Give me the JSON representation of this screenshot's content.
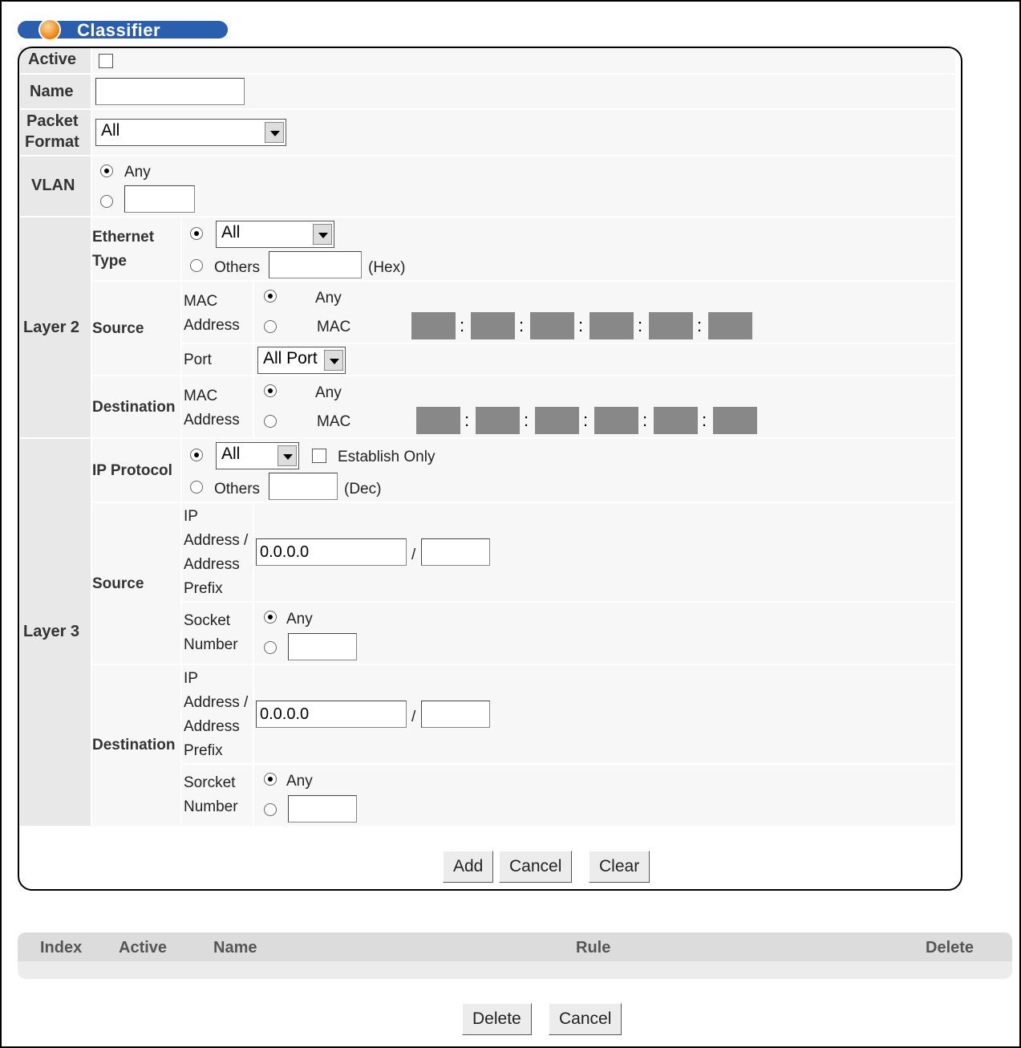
{
  "title": "Classifier",
  "fields": {
    "active_label": "Active",
    "name_label": "Name",
    "name_value": "",
    "packet_label_1": "Packet",
    "packet_label_2": "Format",
    "packet_value": "All",
    "vlan_label": "VLAN",
    "vlan_any": "Any",
    "vlan_value": ""
  },
  "layer2": {
    "label": "Layer 2",
    "ethernet_label_1": "Ethernet",
    "ethernet_label_2": "Type",
    "ethernet_select": "All",
    "others_label": "Others",
    "others_value": "",
    "hex_label": "(Hex)",
    "source_label": "Source",
    "mac_label_1": "MAC",
    "mac_label_2": "Address",
    "any_label": "Any",
    "mac_option": "MAC",
    "port_label": "Port",
    "port_select": "All Port",
    "destination_label": "Destination"
  },
  "layer3": {
    "label": "Layer 3",
    "ip_protocol_label": "IP Protocol",
    "ip_protocol_select": "All",
    "establish_only": "Establish Only",
    "others_label": "Others",
    "others_value": "",
    "dec_label": "(Dec)",
    "source_label": "Source",
    "ip_label_1": "IP",
    "ip_label_2": "Address /",
    "ip_label_3": "Address",
    "ip_label_4": "Prefix",
    "source_ip": "0.0.0.0",
    "source_prefix": "",
    "slash": "/",
    "socket_label_1": "Socket",
    "socket_label_2": "Number",
    "any_label": "Any",
    "source_socket": "",
    "destination_label": "Destination",
    "dest_ip": "0.0.0.0",
    "dest_prefix": "",
    "dest_socket_label_1": "Sorcket",
    "dest_socket_label_2": "Number",
    "dest_socket": ""
  },
  "buttons": {
    "add": "Add",
    "cancel": "Cancel",
    "clear": "Clear",
    "delete": "Delete",
    "cancel2": "Cancel"
  },
  "list": {
    "headers": [
      "Index",
      "Active",
      "Name",
      "Rule",
      "Delete"
    ]
  }
}
